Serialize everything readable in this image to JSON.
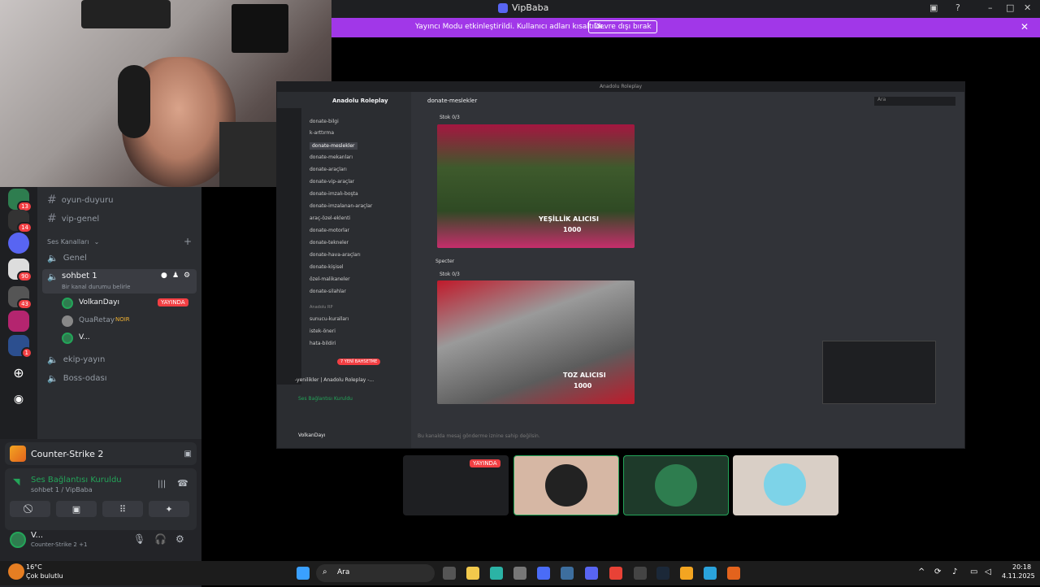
{
  "window": {
    "title": "VipBaba"
  },
  "banner": {
    "text": "Yayıncı Modu etkinleştirildi. Kullanıcı adları kısaltıldı.",
    "button": "Devre dışı bırak"
  },
  "channels": {
    "text": [
      "oyun-duyuru",
      "vip-genel"
    ],
    "voice_header": "Ses Kanalları",
    "voice": [
      {
        "name": "Genel"
      },
      {
        "name": "sohbet 1",
        "sub": "Bir kanal durumu belirle"
      }
    ],
    "members": [
      {
        "name": "VolkanDayı",
        "badge": "YAYINDA"
      },
      {
        "name": "QuaRetay",
        "tag": "NOIR"
      },
      {
        "name": "V..."
      }
    ],
    "more": [
      "ekip-yayın",
      "Boss-odası"
    ],
    "badges": [
      "13",
      "14",
      "90",
      "43",
      "1"
    ]
  },
  "activity": {
    "game": "Counter-Strike 2"
  },
  "connection": {
    "title": "Ses Bağlantısı Kuruldu",
    "sub": "sohbet 1 / VipBaba"
  },
  "user": {
    "name": "V...",
    "status": "Counter-Strike 2 +1"
  },
  "stream": {
    "server": "Anadolu Roleplay",
    "channel": "donate-meslekler",
    "search": "Ara",
    "items": [
      "donate-bilgi",
      "k-arttırma",
      "donate-meslekler",
      "donate-mekanları",
      "donate-araçları",
      "donate-vip-araçlar",
      "donate-imzalı-boşta",
      "donate-imzalanan-araçlar",
      "araç-özel-eklenti",
      "donate-motorlar",
      "donate-tekneler",
      "donate-hava-araçları",
      "donate-kişisel",
      "özel-malikaneler",
      "donate-silahlar"
    ],
    "cat": "Anadolu RP",
    "cat_items": [
      "sunucu-kuralları",
      "istek-öneri",
      "hata-bildiri"
    ],
    "stok1": "Stok 0/3",
    "stok2": "Stok 0/3",
    "img1_title": "YEŞİLLİK ALICISI",
    "img1_num": "1000",
    "img2_title": "TOZ ALICISI",
    "img2_num": "1000",
    "sender": "Specter",
    "input": "Bu kanalda mesaj gönderme iznine sahip değilsin.",
    "mini_conn": "Ses Bağlantısı Kuruldu",
    "mini_user": "VolkanDayı",
    "mini_chan": "-yenilikler | Anadolu Roleplay -...",
    "newmsg": "7 YENİ BAHSETME"
  },
  "thumbs": {
    "live": "YAYINDA"
  },
  "taskbar": {
    "weather_temp": "16°C",
    "weather_desc": "Çok bulutlu",
    "search": "Ara",
    "time": "20:18",
    "date": "4.11.2025"
  },
  "colors": {
    "accent": "#a137e8",
    "green": "#23a559",
    "red": "#f23f43"
  }
}
